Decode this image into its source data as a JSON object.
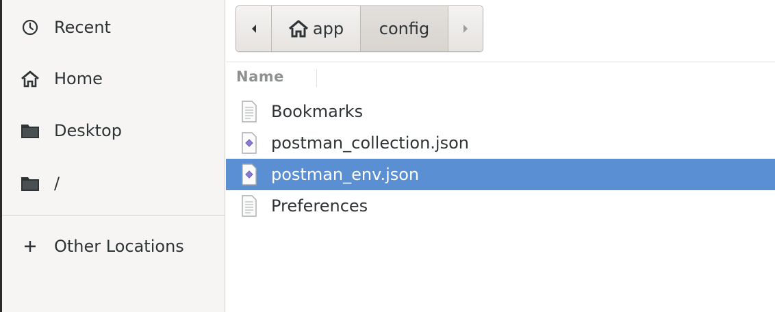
{
  "sidebar": {
    "items": [
      {
        "label": "Recent",
        "icon": "clock-icon"
      },
      {
        "label": "Home",
        "icon": "home-icon"
      },
      {
        "label": "Desktop",
        "icon": "folder-icon"
      },
      {
        "label": "/",
        "icon": "folder-icon"
      }
    ],
    "other_locations": {
      "label": "Other Locations",
      "icon": "plus-icon"
    }
  },
  "pathbar": {
    "back_icon": "chevron-left-icon",
    "crumbs": [
      {
        "label": "app",
        "icon": "home-icon"
      },
      {
        "label": "config"
      }
    ],
    "forward_icon": "chevron-right-icon"
  },
  "list": {
    "column_header": "Name",
    "files": [
      {
        "name": "Bookmarks",
        "icon": "text-file-icon"
      },
      {
        "name": "postman_collection.json",
        "icon": "json-file-icon"
      },
      {
        "name": "postman_env.json",
        "icon": "json-file-icon",
        "selected": true
      },
      {
        "name": "Preferences",
        "icon": "text-file-icon"
      }
    ]
  },
  "colors": {
    "selection": "#5b8fd4",
    "sidebar_bg": "#f6f5f4"
  }
}
